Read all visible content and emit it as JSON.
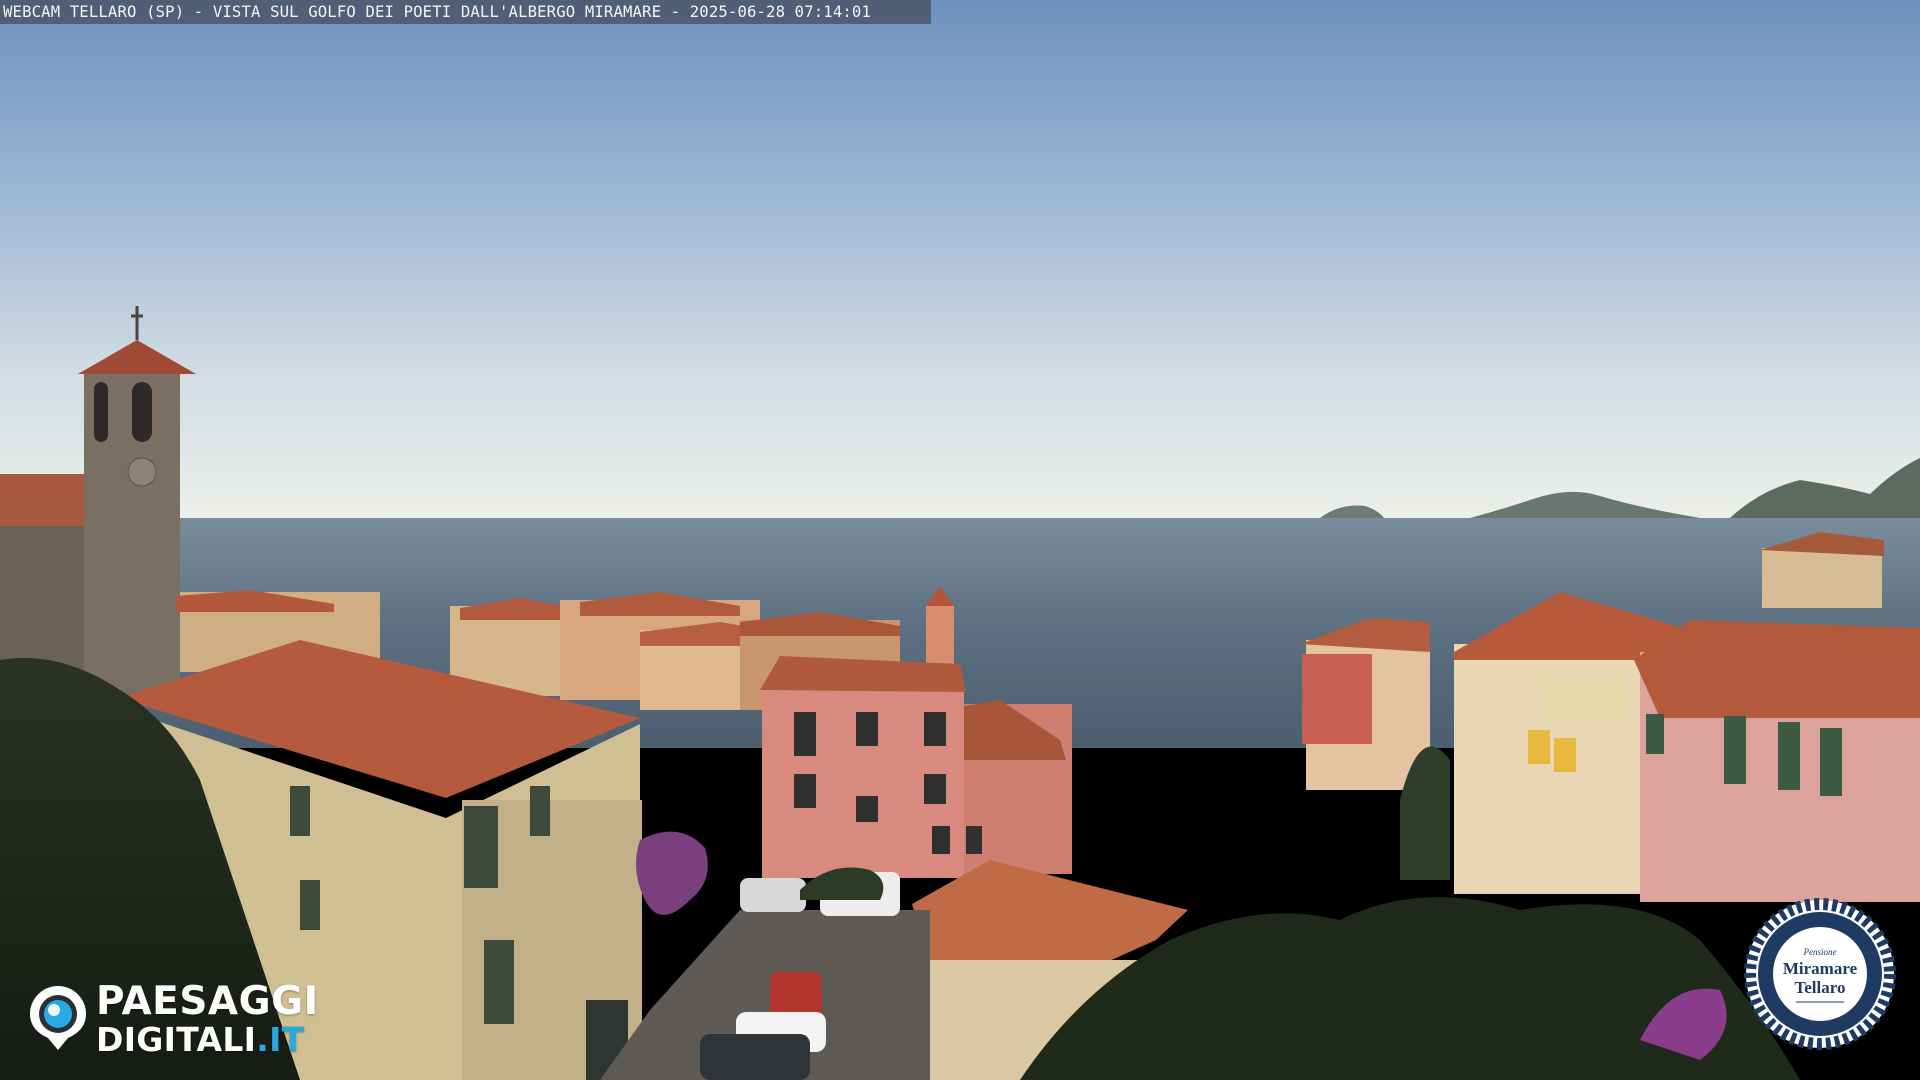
{
  "webcam": {
    "caption": "WEBCAM TELLARO (SP) - VISTA SUL GOLFO DEI POETI DALL'ALBERGO MIRAMARE - 2025-06-28 07:14:01"
  },
  "branding": {
    "logo_primary": "PAESAGGI",
    "logo_secondary": "DIGITALI",
    "logo_suffix": ".IT"
  },
  "hotel_seal": {
    "top_text": "Pensione",
    "name_line1": "Miramare",
    "name_line2": "Tellaro"
  },
  "colors": {
    "sky_top": "#7b9bc4",
    "sky_horizon": "#e6ecea",
    "sea": "#5a7082",
    "roof_terracotta": "#b45a3c",
    "accent_blue": "#29a9e1",
    "seal_navy": "#1f3a63"
  },
  "icons": {
    "brand_mark": "eye-pin-icon",
    "seal": "rope-seal-icon"
  }
}
